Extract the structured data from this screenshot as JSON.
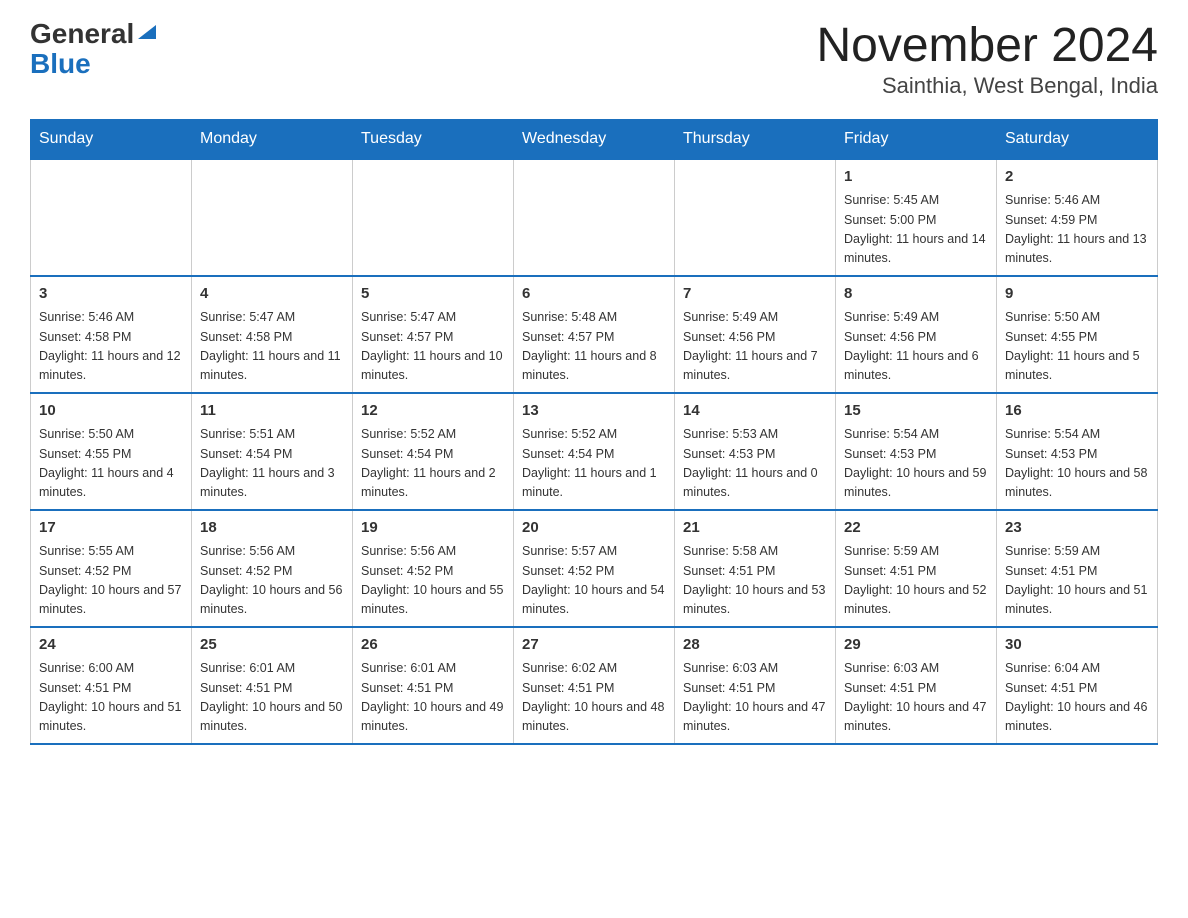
{
  "header": {
    "logo_general": "General",
    "logo_blue": "Blue",
    "month_title": "November 2024",
    "location": "Sainthia, West Bengal, India"
  },
  "days_of_week": [
    "Sunday",
    "Monday",
    "Tuesday",
    "Wednesday",
    "Thursday",
    "Friday",
    "Saturday"
  ],
  "weeks": [
    [
      {
        "day": "",
        "info": ""
      },
      {
        "day": "",
        "info": ""
      },
      {
        "day": "",
        "info": ""
      },
      {
        "day": "",
        "info": ""
      },
      {
        "day": "",
        "info": ""
      },
      {
        "day": "1",
        "info": "Sunrise: 5:45 AM\nSunset: 5:00 PM\nDaylight: 11 hours and 14 minutes."
      },
      {
        "day": "2",
        "info": "Sunrise: 5:46 AM\nSunset: 4:59 PM\nDaylight: 11 hours and 13 minutes."
      }
    ],
    [
      {
        "day": "3",
        "info": "Sunrise: 5:46 AM\nSunset: 4:58 PM\nDaylight: 11 hours and 12 minutes."
      },
      {
        "day": "4",
        "info": "Sunrise: 5:47 AM\nSunset: 4:58 PM\nDaylight: 11 hours and 11 minutes."
      },
      {
        "day": "5",
        "info": "Sunrise: 5:47 AM\nSunset: 4:57 PM\nDaylight: 11 hours and 10 minutes."
      },
      {
        "day": "6",
        "info": "Sunrise: 5:48 AM\nSunset: 4:57 PM\nDaylight: 11 hours and 8 minutes."
      },
      {
        "day": "7",
        "info": "Sunrise: 5:49 AM\nSunset: 4:56 PM\nDaylight: 11 hours and 7 minutes."
      },
      {
        "day": "8",
        "info": "Sunrise: 5:49 AM\nSunset: 4:56 PM\nDaylight: 11 hours and 6 minutes."
      },
      {
        "day": "9",
        "info": "Sunrise: 5:50 AM\nSunset: 4:55 PM\nDaylight: 11 hours and 5 minutes."
      }
    ],
    [
      {
        "day": "10",
        "info": "Sunrise: 5:50 AM\nSunset: 4:55 PM\nDaylight: 11 hours and 4 minutes."
      },
      {
        "day": "11",
        "info": "Sunrise: 5:51 AM\nSunset: 4:54 PM\nDaylight: 11 hours and 3 minutes."
      },
      {
        "day": "12",
        "info": "Sunrise: 5:52 AM\nSunset: 4:54 PM\nDaylight: 11 hours and 2 minutes."
      },
      {
        "day": "13",
        "info": "Sunrise: 5:52 AM\nSunset: 4:54 PM\nDaylight: 11 hours and 1 minute."
      },
      {
        "day": "14",
        "info": "Sunrise: 5:53 AM\nSunset: 4:53 PM\nDaylight: 11 hours and 0 minutes."
      },
      {
        "day": "15",
        "info": "Sunrise: 5:54 AM\nSunset: 4:53 PM\nDaylight: 10 hours and 59 minutes."
      },
      {
        "day": "16",
        "info": "Sunrise: 5:54 AM\nSunset: 4:53 PM\nDaylight: 10 hours and 58 minutes."
      }
    ],
    [
      {
        "day": "17",
        "info": "Sunrise: 5:55 AM\nSunset: 4:52 PM\nDaylight: 10 hours and 57 minutes."
      },
      {
        "day": "18",
        "info": "Sunrise: 5:56 AM\nSunset: 4:52 PM\nDaylight: 10 hours and 56 minutes."
      },
      {
        "day": "19",
        "info": "Sunrise: 5:56 AM\nSunset: 4:52 PM\nDaylight: 10 hours and 55 minutes."
      },
      {
        "day": "20",
        "info": "Sunrise: 5:57 AM\nSunset: 4:52 PM\nDaylight: 10 hours and 54 minutes."
      },
      {
        "day": "21",
        "info": "Sunrise: 5:58 AM\nSunset: 4:51 PM\nDaylight: 10 hours and 53 minutes."
      },
      {
        "day": "22",
        "info": "Sunrise: 5:59 AM\nSunset: 4:51 PM\nDaylight: 10 hours and 52 minutes."
      },
      {
        "day": "23",
        "info": "Sunrise: 5:59 AM\nSunset: 4:51 PM\nDaylight: 10 hours and 51 minutes."
      }
    ],
    [
      {
        "day": "24",
        "info": "Sunrise: 6:00 AM\nSunset: 4:51 PM\nDaylight: 10 hours and 51 minutes."
      },
      {
        "day": "25",
        "info": "Sunrise: 6:01 AM\nSunset: 4:51 PM\nDaylight: 10 hours and 50 minutes."
      },
      {
        "day": "26",
        "info": "Sunrise: 6:01 AM\nSunset: 4:51 PM\nDaylight: 10 hours and 49 minutes."
      },
      {
        "day": "27",
        "info": "Sunrise: 6:02 AM\nSunset: 4:51 PM\nDaylight: 10 hours and 48 minutes."
      },
      {
        "day": "28",
        "info": "Sunrise: 6:03 AM\nSunset: 4:51 PM\nDaylight: 10 hours and 47 minutes."
      },
      {
        "day": "29",
        "info": "Sunrise: 6:03 AM\nSunset: 4:51 PM\nDaylight: 10 hours and 47 minutes."
      },
      {
        "day": "30",
        "info": "Sunrise: 6:04 AM\nSunset: 4:51 PM\nDaylight: 10 hours and 46 minutes."
      }
    ]
  ]
}
